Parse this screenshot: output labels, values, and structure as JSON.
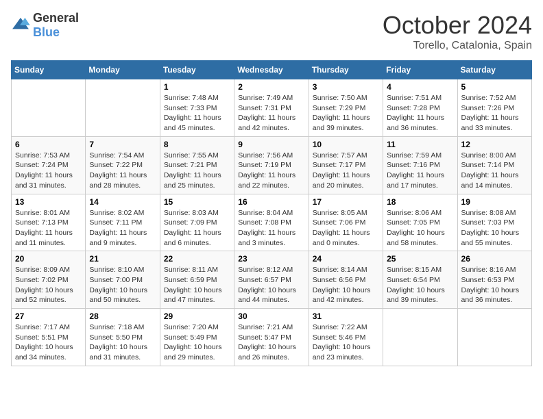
{
  "header": {
    "logo": {
      "general": "General",
      "blue": "Blue"
    },
    "month": "October 2024",
    "location": "Torello, Catalonia, Spain"
  },
  "weekdays": [
    "Sunday",
    "Monday",
    "Tuesday",
    "Wednesday",
    "Thursday",
    "Friday",
    "Saturday"
  ],
  "weeks": [
    [
      {
        "day": "",
        "info": ""
      },
      {
        "day": "",
        "info": ""
      },
      {
        "day": "1",
        "info": "Sunrise: 7:48 AM\nSunset: 7:33 PM\nDaylight: 11 hours and 45 minutes."
      },
      {
        "day": "2",
        "info": "Sunrise: 7:49 AM\nSunset: 7:31 PM\nDaylight: 11 hours and 42 minutes."
      },
      {
        "day": "3",
        "info": "Sunrise: 7:50 AM\nSunset: 7:29 PM\nDaylight: 11 hours and 39 minutes."
      },
      {
        "day": "4",
        "info": "Sunrise: 7:51 AM\nSunset: 7:28 PM\nDaylight: 11 hours and 36 minutes."
      },
      {
        "day": "5",
        "info": "Sunrise: 7:52 AM\nSunset: 7:26 PM\nDaylight: 11 hours and 33 minutes."
      }
    ],
    [
      {
        "day": "6",
        "info": "Sunrise: 7:53 AM\nSunset: 7:24 PM\nDaylight: 11 hours and 31 minutes."
      },
      {
        "day": "7",
        "info": "Sunrise: 7:54 AM\nSunset: 7:22 PM\nDaylight: 11 hours and 28 minutes."
      },
      {
        "day": "8",
        "info": "Sunrise: 7:55 AM\nSunset: 7:21 PM\nDaylight: 11 hours and 25 minutes."
      },
      {
        "day": "9",
        "info": "Sunrise: 7:56 AM\nSunset: 7:19 PM\nDaylight: 11 hours and 22 minutes."
      },
      {
        "day": "10",
        "info": "Sunrise: 7:57 AM\nSunset: 7:17 PM\nDaylight: 11 hours and 20 minutes."
      },
      {
        "day": "11",
        "info": "Sunrise: 7:59 AM\nSunset: 7:16 PM\nDaylight: 11 hours and 17 minutes."
      },
      {
        "day": "12",
        "info": "Sunrise: 8:00 AM\nSunset: 7:14 PM\nDaylight: 11 hours and 14 minutes."
      }
    ],
    [
      {
        "day": "13",
        "info": "Sunrise: 8:01 AM\nSunset: 7:13 PM\nDaylight: 11 hours and 11 minutes."
      },
      {
        "day": "14",
        "info": "Sunrise: 8:02 AM\nSunset: 7:11 PM\nDaylight: 11 hours and 9 minutes."
      },
      {
        "day": "15",
        "info": "Sunrise: 8:03 AM\nSunset: 7:09 PM\nDaylight: 11 hours and 6 minutes."
      },
      {
        "day": "16",
        "info": "Sunrise: 8:04 AM\nSunset: 7:08 PM\nDaylight: 11 hours and 3 minutes."
      },
      {
        "day": "17",
        "info": "Sunrise: 8:05 AM\nSunset: 7:06 PM\nDaylight: 11 hours and 0 minutes."
      },
      {
        "day": "18",
        "info": "Sunrise: 8:06 AM\nSunset: 7:05 PM\nDaylight: 10 hours and 58 minutes."
      },
      {
        "day": "19",
        "info": "Sunrise: 8:08 AM\nSunset: 7:03 PM\nDaylight: 10 hours and 55 minutes."
      }
    ],
    [
      {
        "day": "20",
        "info": "Sunrise: 8:09 AM\nSunset: 7:02 PM\nDaylight: 10 hours and 52 minutes."
      },
      {
        "day": "21",
        "info": "Sunrise: 8:10 AM\nSunset: 7:00 PM\nDaylight: 10 hours and 50 minutes."
      },
      {
        "day": "22",
        "info": "Sunrise: 8:11 AM\nSunset: 6:59 PM\nDaylight: 10 hours and 47 minutes."
      },
      {
        "day": "23",
        "info": "Sunrise: 8:12 AM\nSunset: 6:57 PM\nDaylight: 10 hours and 44 minutes."
      },
      {
        "day": "24",
        "info": "Sunrise: 8:14 AM\nSunset: 6:56 PM\nDaylight: 10 hours and 42 minutes."
      },
      {
        "day": "25",
        "info": "Sunrise: 8:15 AM\nSunset: 6:54 PM\nDaylight: 10 hours and 39 minutes."
      },
      {
        "day": "26",
        "info": "Sunrise: 8:16 AM\nSunset: 6:53 PM\nDaylight: 10 hours and 36 minutes."
      }
    ],
    [
      {
        "day": "27",
        "info": "Sunrise: 7:17 AM\nSunset: 5:51 PM\nDaylight: 10 hours and 34 minutes."
      },
      {
        "day": "28",
        "info": "Sunrise: 7:18 AM\nSunset: 5:50 PM\nDaylight: 10 hours and 31 minutes."
      },
      {
        "day": "29",
        "info": "Sunrise: 7:20 AM\nSunset: 5:49 PM\nDaylight: 10 hours and 29 minutes."
      },
      {
        "day": "30",
        "info": "Sunrise: 7:21 AM\nSunset: 5:47 PM\nDaylight: 10 hours and 26 minutes."
      },
      {
        "day": "31",
        "info": "Sunrise: 7:22 AM\nSunset: 5:46 PM\nDaylight: 10 hours and 23 minutes."
      },
      {
        "day": "",
        "info": ""
      },
      {
        "day": "",
        "info": ""
      }
    ]
  ]
}
